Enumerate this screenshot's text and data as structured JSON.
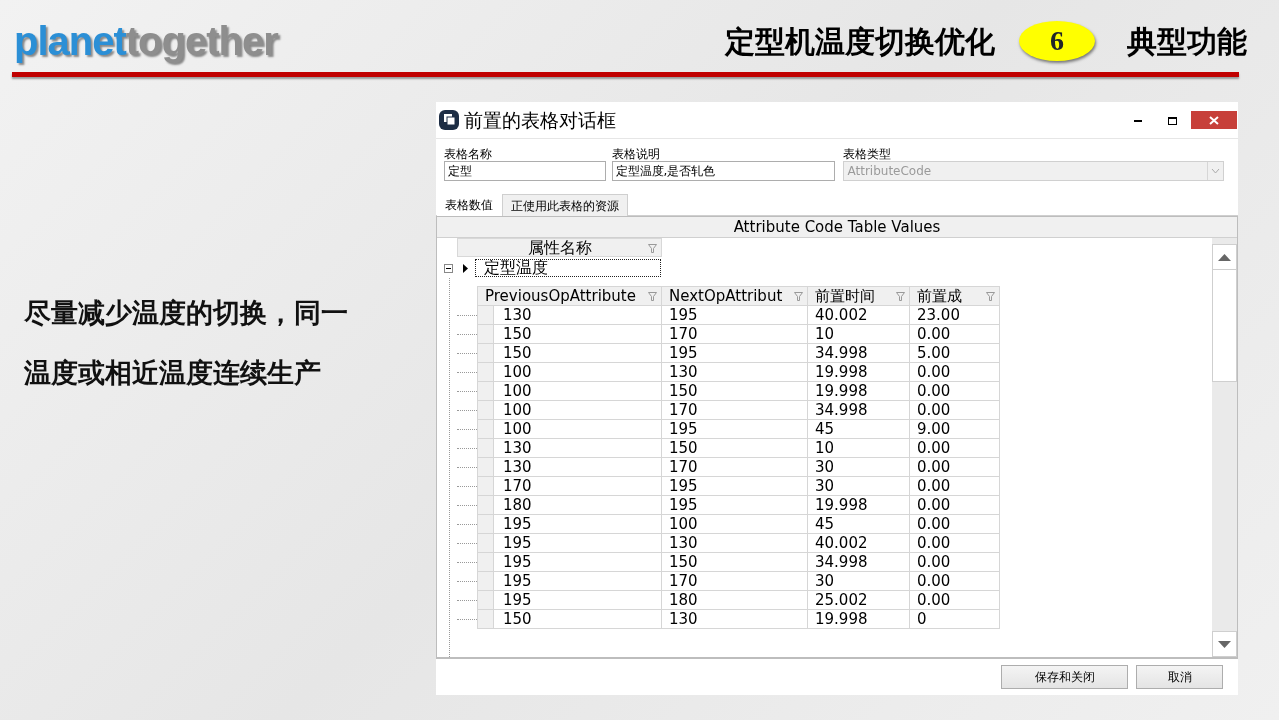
{
  "slide": {
    "logo": {
      "part_1": "planet",
      "part_2": "together"
    },
    "title": "定型机温度切换优化",
    "badge": "6",
    "section": "典型功能",
    "body_text": "尽量减少温度的切换，同一温度或相近温度连续生产"
  },
  "dialog": {
    "title": "前置的表格对话框",
    "fields": [
      {
        "kind": "text",
        "label": "表格名称",
        "value": "定型",
        "disabled": false
      },
      {
        "kind": "text",
        "label": "表格说明",
        "value": "定型温度,是否轧色",
        "disabled": false
      },
      {
        "kind": "dropdown",
        "label": "表格类型",
        "value": "AttributeCode",
        "disabled": true
      }
    ],
    "tabs": [
      {
        "label": "表格数值",
        "selected": true
      },
      {
        "label": "正使用此表格的资源",
        "selected": false
      }
    ],
    "grid": {
      "caption": "Attribute Code Table Values",
      "band_column": "属性名称",
      "groups": [
        {
          "name": "定型温度",
          "expanded": true,
          "columns": [
            "PreviousOpAttribute",
            "NextOpAttribut",
            "前置时间",
            "前置成"
          ],
          "rows": [
            [
              "130",
              "195",
              "40.002",
              "23.00"
            ],
            [
              "150",
              "170",
              "10",
              "0.00"
            ],
            [
              "150",
              "195",
              "34.998",
              "5.00"
            ],
            [
              "100",
              "130",
              "19.998",
              "0.00"
            ],
            [
              "100",
              "150",
              "19.998",
              "0.00"
            ],
            [
              "100",
              "170",
              "34.998",
              "0.00"
            ],
            [
              "100",
              "195",
              "45",
              "9.00"
            ],
            [
              "130",
              "150",
              "10",
              "0.00"
            ],
            [
              "130",
              "170",
              "30",
              "0.00"
            ],
            [
              "170",
              "195",
              "30",
              "0.00"
            ],
            [
              "180",
              "195",
              "19.998",
              "0.00"
            ],
            [
              "195",
              "100",
              "45",
              "0.00"
            ],
            [
              "195",
              "130",
              "40.002",
              "0.00"
            ],
            [
              "195",
              "150",
              "34.998",
              "0.00"
            ],
            [
              "195",
              "170",
              "30",
              "0.00"
            ],
            [
              "195",
              "180",
              "25.002",
              "0.00"
            ],
            [
              "150",
              "130",
              "19.998",
              "0"
            ]
          ]
        }
      ]
    },
    "buttons": [
      "保存和关闭",
      "取消"
    ]
  }
}
